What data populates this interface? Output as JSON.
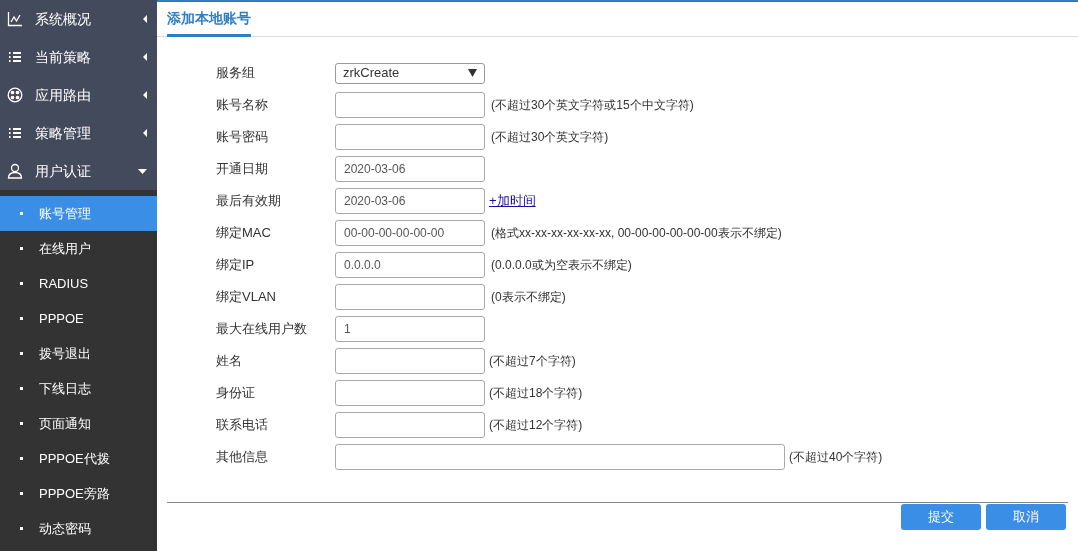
{
  "sidebar": {
    "items": [
      {
        "label": "系统概况",
        "expanded": false
      },
      {
        "label": "当前策略",
        "expanded": false
      },
      {
        "label": "应用路由",
        "expanded": false
      },
      {
        "label": "策略管理",
        "expanded": false
      },
      {
        "label": "用户认证",
        "expanded": true,
        "children": [
          {
            "label": "账号管理",
            "selected": true
          },
          {
            "label": "在线用户",
            "selected": false
          },
          {
            "label": "RADIUS",
            "selected": false
          },
          {
            "label": "PPPOE",
            "selected": false
          },
          {
            "label": "拨号退出",
            "selected": false
          },
          {
            "label": "下线日志",
            "selected": false
          },
          {
            "label": "页面通知",
            "selected": false
          },
          {
            "label": "PPPOE代拨",
            "selected": false
          },
          {
            "label": "PPPOE旁路",
            "selected": false
          },
          {
            "label": "动态密码",
            "selected": false
          }
        ]
      }
    ]
  },
  "tab": {
    "label": "添加本地账号",
    "selected": true
  },
  "form": {
    "rows": [
      {
        "label": "服务组",
        "kind": "select",
        "value": "zrkCreate"
      },
      {
        "label": "账号名称",
        "kind": "input",
        "value": "",
        "hint": "(不超过30个英文字符或15个中文字符)"
      },
      {
        "label": "账号密码",
        "kind": "input",
        "value": "",
        "hint": "(不超过30个英文字符)"
      },
      {
        "label": "开通日期",
        "kind": "input",
        "value": "2020-03-06"
      },
      {
        "label": "最后有效期",
        "kind": "input",
        "value": "2020-03-06",
        "link": "+加时间"
      },
      {
        "label": "绑定MAC",
        "kind": "input",
        "value": "00-00-00-00-00-00",
        "hint": "(格式xx-xx-xx-xx-xx-xx, 00-00-00-00-00-00表示不绑定)"
      },
      {
        "label": "绑定IP",
        "kind": "input",
        "value": "0.0.0.0",
        "hint": "(0.0.0.0或为空表示不绑定)"
      },
      {
        "label": "绑定VLAN",
        "kind": "input",
        "value": "",
        "hint": "(0表示不绑定)"
      },
      {
        "label": "最大在线用户数",
        "kind": "input",
        "value": "1"
      },
      {
        "label": "姓名",
        "kind": "input",
        "value": "",
        "hint": "(不超过7个字符)"
      },
      {
        "label": "身份证",
        "kind": "input",
        "value": "",
        "hint": "(不超过18个字符)"
      },
      {
        "label": "联系电话",
        "kind": "input",
        "value": "",
        "hint": "(不超过12个字符)"
      },
      {
        "label": "其他信息",
        "kind": "wide",
        "value": "",
        "hint": "(不超过40个字符)"
      }
    ]
  },
  "buttons": [
    "提交",
    "取消"
  ]
}
